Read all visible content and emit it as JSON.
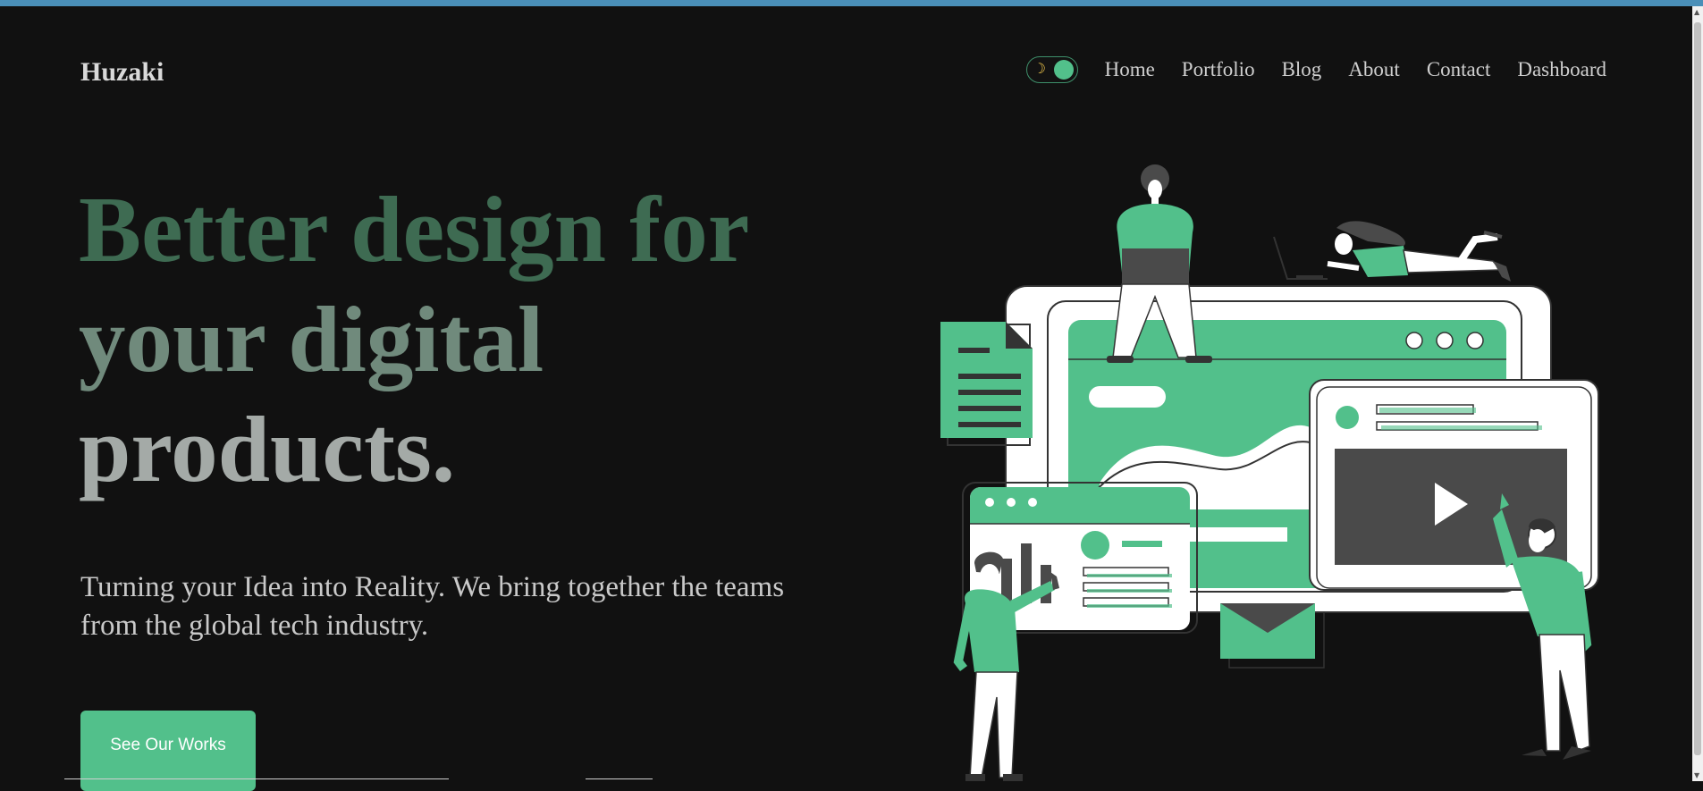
{
  "site": {
    "logo": "Huzaki"
  },
  "nav": {
    "theme_toggle_icon": "moon-icon",
    "items": [
      {
        "label": "Home"
      },
      {
        "label": "Portfolio"
      },
      {
        "label": "Blog"
      },
      {
        "label": "About"
      },
      {
        "label": "Contact"
      },
      {
        "label": "Dashboard"
      }
    ]
  },
  "hero": {
    "headline_lines": [
      "Better design for",
      "your digital",
      "products."
    ],
    "subtitle": "Turning your Idea into Reality. We bring together the teams from the global tech industry.",
    "cta_label": "See Our Works"
  },
  "colors": {
    "background": "#111111",
    "accent": "#52c08b",
    "headline_1": "#3e6b52",
    "headline_2": "#708a7c",
    "headline_3": "#a4aaa7",
    "text": "#c9c9c9"
  }
}
